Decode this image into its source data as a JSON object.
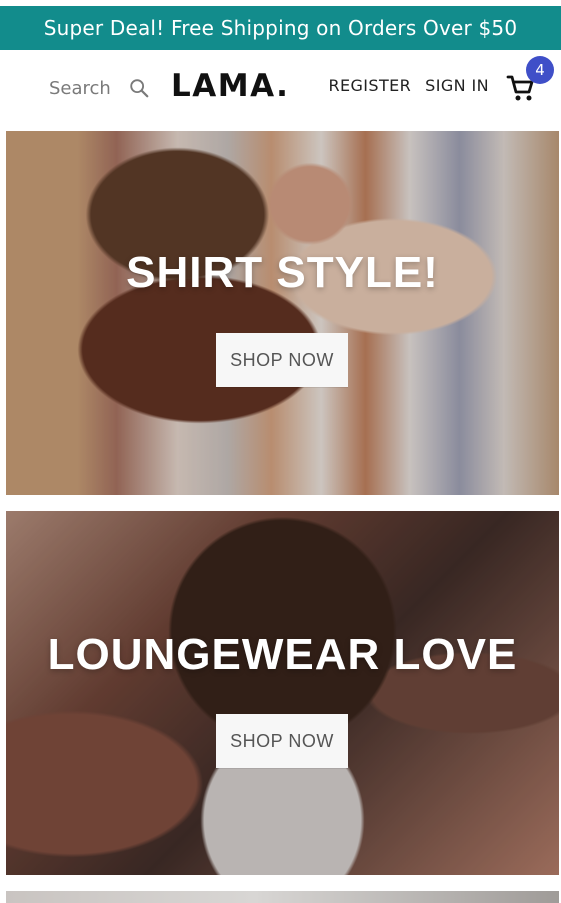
{
  "announcement": {
    "text": "Super Deal! Free Shipping on Orders Over $50"
  },
  "navbar": {
    "search_label": "Search",
    "logo": "LAMA.",
    "links": {
      "register": "REGISTER",
      "sign_in": "SIGN IN"
    },
    "cart_count": "4"
  },
  "slides": [
    {
      "title": "SHIRT STYLE!",
      "button": "SHOP NOW"
    },
    {
      "title": "LOUNGEWEAR LOVE",
      "button": "SHOP NOW"
    }
  ],
  "icons": {
    "search": "search-icon",
    "cart": "shopping-cart-icon"
  },
  "colors": {
    "announcement": "#128c8c",
    "cart_badge": "#3f4fc8"
  }
}
